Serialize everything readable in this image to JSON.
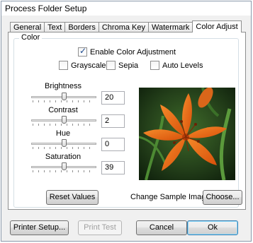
{
  "window": {
    "title": "Process Folder Setup"
  },
  "tabs": [
    "General",
    "Text",
    "Borders",
    "Chroma Key",
    "Watermark",
    "Color Adjust"
  ],
  "color_group": {
    "legend": "Color",
    "enable": {
      "label": "Enable Color Adjustment",
      "checked": true
    },
    "grayscale": {
      "label": "Grayscale",
      "checked": false
    },
    "sepia": {
      "label": "Sepia",
      "checked": false
    },
    "auto_levels": {
      "label": "Auto Levels",
      "checked": false
    },
    "sliders": [
      {
        "label": "Brightness",
        "value": "20"
      },
      {
        "label": "Contrast",
        "value": "2"
      },
      {
        "label": "Hue",
        "value": "0"
      },
      {
        "label": "Saturation",
        "value": "39"
      }
    ],
    "reset_label": "Reset Values",
    "change_sample_label": "Change Sample Image:",
    "choose_label": "Choose..."
  },
  "footer": {
    "printer_setup": "Printer Setup...",
    "print_test": "Print Test",
    "cancel": "Cancel",
    "ok": "Ok"
  },
  "colors": {
    "accent": "#1c4a8f",
    "window_border": "#8a99ab",
    "petal": "#e8620f",
    "leaf": "#2f5a22"
  },
  "icons": {
    "check": "checkmark-icon",
    "sample_image": "orange-lily-photo"
  }
}
